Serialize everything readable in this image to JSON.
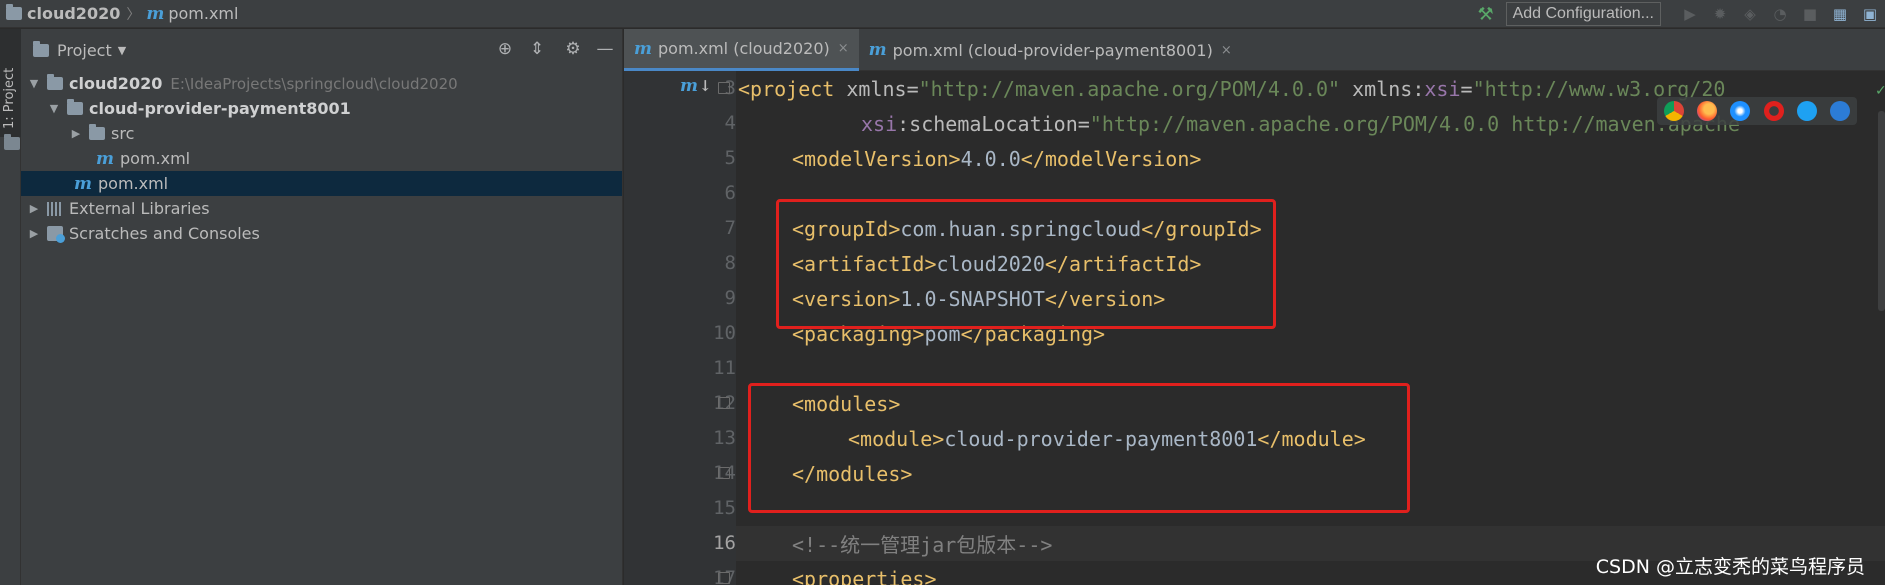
{
  "navbar": {
    "project": "cloud2020",
    "separator": "〉",
    "file": "pom.xml",
    "add_configuration": "Add Configuration..."
  },
  "tool_strip": {
    "label": "1: Project"
  },
  "project_panel": {
    "title": "Project",
    "tree": [
      {
        "label": "cloud2020",
        "path": "E:\\IdeaProjects\\springcloud\\cloud2020",
        "expanded": true,
        "depth": 0,
        "icon": "module-folder-icon"
      },
      {
        "label": "cloud-provider-payment8001",
        "expanded": true,
        "depth": 1,
        "icon": "module-folder-icon"
      },
      {
        "label": "src",
        "expanded": false,
        "depth": 2,
        "icon": "folder-icon"
      },
      {
        "label": "pom.xml",
        "depth": 2,
        "icon": "maven-icon"
      },
      {
        "label": "pom.xml",
        "depth": 1,
        "icon": "maven-icon",
        "selected": true
      },
      {
        "label": "External Libraries",
        "expanded": false,
        "depth": 0,
        "icon": "library-icon"
      },
      {
        "label": "Scratches and Consoles",
        "expanded": false,
        "depth": 0,
        "icon": "scratches-icon"
      }
    ]
  },
  "tabs": [
    {
      "label": "pom.xml (cloud2020)",
      "active": true,
      "close": "×"
    },
    {
      "label": "pom.xml (cloud-provider-payment8001)",
      "active": false,
      "close": "×"
    }
  ],
  "editor": {
    "line_numbers": [
      "3",
      "4",
      "5",
      "6",
      "7",
      "8",
      "9",
      "10",
      "11",
      "12",
      "13",
      "14",
      "15",
      "16",
      "17"
    ],
    "current_line": "16",
    "lines": {
      "l3": {
        "open": "<project ",
        "a1": "xmlns",
        "eq1": "=",
        "v1": "\"http://maven.apache.org/POM/4.0.0\"",
        "sp": " ",
        "a2ns": "xmlns",
        "colon": ":",
        "a2": "xsi",
        "eq2": "=",
        "v2": "\"http://www.w3.org/20"
      },
      "l4": {
        "ns": "xsi",
        "colon": ":",
        "a": "schemaLocation",
        "eq": "=",
        "v": "\"http://maven.apache.org/POM/4.0.0 http://maven.apache"
      },
      "l5": {
        "open": "<modelVersion>",
        "text": "4.0.0",
        "close": "</modelVersion>"
      },
      "l7": {
        "open": "<groupId>",
        "text": "com.huan.springcloud",
        "close": "</groupId>"
      },
      "l8": {
        "open": "<artifactId>",
        "text": "cloud2020",
        "close": "</artifactId>"
      },
      "l9": {
        "open": "<version>",
        "text": "1.0-SNAPSHOT",
        "close": "</version>"
      },
      "l10": {
        "open": "<packaging>",
        "text": "pom",
        "close": "</packaging>"
      },
      "l12": {
        "open": "<modules>"
      },
      "l13": {
        "open": "<module>",
        "text": "cloud-provider-payment8001",
        "close": "</module>"
      },
      "l14": {
        "close": "</modules>"
      },
      "l16": {
        "comment": "<!--统一管理jar包版本-->"
      },
      "l17": {
        "open": "<properties>"
      }
    }
  },
  "watermark": "CSDN @立志变秃的菜鸟程序员",
  "colors": {
    "tag": "#e8bf6a",
    "text": "#a9b7c6",
    "namespace": "#9876aa",
    "string": "#6a8759",
    "comment": "#808080",
    "highlight_box": "#e0201d",
    "selection": "#0d293e"
  }
}
